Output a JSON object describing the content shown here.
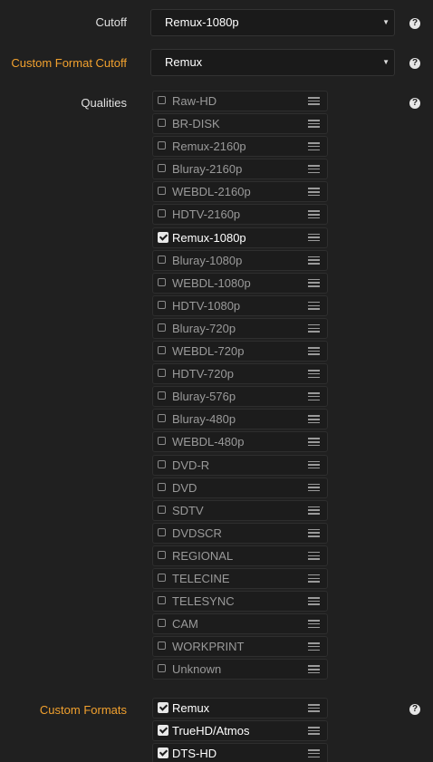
{
  "cutoff": {
    "label": "Cutoff",
    "value": "Remux-1080p"
  },
  "custom_format_cutoff": {
    "label": "Custom Format Cutoff",
    "value": "Remux"
  },
  "qualities": {
    "label": "Qualities",
    "items": [
      {
        "label": "Raw-HD",
        "checked": false
      },
      {
        "label": "BR-DISK",
        "checked": false
      },
      {
        "label": "Remux-2160p",
        "checked": false
      },
      {
        "label": "Bluray-2160p",
        "checked": false
      },
      {
        "label": "WEBDL-2160p",
        "checked": false
      },
      {
        "label": "HDTV-2160p",
        "checked": false
      },
      {
        "label": "Remux-1080p",
        "checked": true
      },
      {
        "label": "Bluray-1080p",
        "checked": false
      },
      {
        "label": "WEBDL-1080p",
        "checked": false
      },
      {
        "label": "HDTV-1080p",
        "checked": false
      },
      {
        "label": "Bluray-720p",
        "checked": false
      },
      {
        "label": "WEBDL-720p",
        "checked": false
      },
      {
        "label": "HDTV-720p",
        "checked": false
      },
      {
        "label": "Bluray-576p",
        "checked": false
      },
      {
        "label": "Bluray-480p",
        "checked": false
      },
      {
        "label": "WEBDL-480p",
        "checked": false
      },
      {
        "label": "DVD-R",
        "checked": false
      },
      {
        "label": "DVD",
        "checked": false
      },
      {
        "label": "SDTV",
        "checked": false
      },
      {
        "label": "DVDSCR",
        "checked": false
      },
      {
        "label": "REGIONAL",
        "checked": false
      },
      {
        "label": "TELECINE",
        "checked": false
      },
      {
        "label": "TELESYNC",
        "checked": false
      },
      {
        "label": "CAM",
        "checked": false
      },
      {
        "label": "WORKPRINT",
        "checked": false
      },
      {
        "label": "Unknown",
        "checked": false
      }
    ]
  },
  "custom_formats": {
    "label": "Custom Formats",
    "items": [
      {
        "label": "Remux",
        "checked": true
      },
      {
        "label": "TrueHD/Atmos",
        "checked": true
      },
      {
        "label": "DTS-HD",
        "checked": true
      }
    ]
  },
  "help_icon_glyph": "?",
  "caret_glyph": "▼",
  "colors": {
    "background": "#202020",
    "accent_label": "#f2a12e",
    "checked_text": "#ffffff",
    "unchecked_text": "#9a9a9a"
  }
}
